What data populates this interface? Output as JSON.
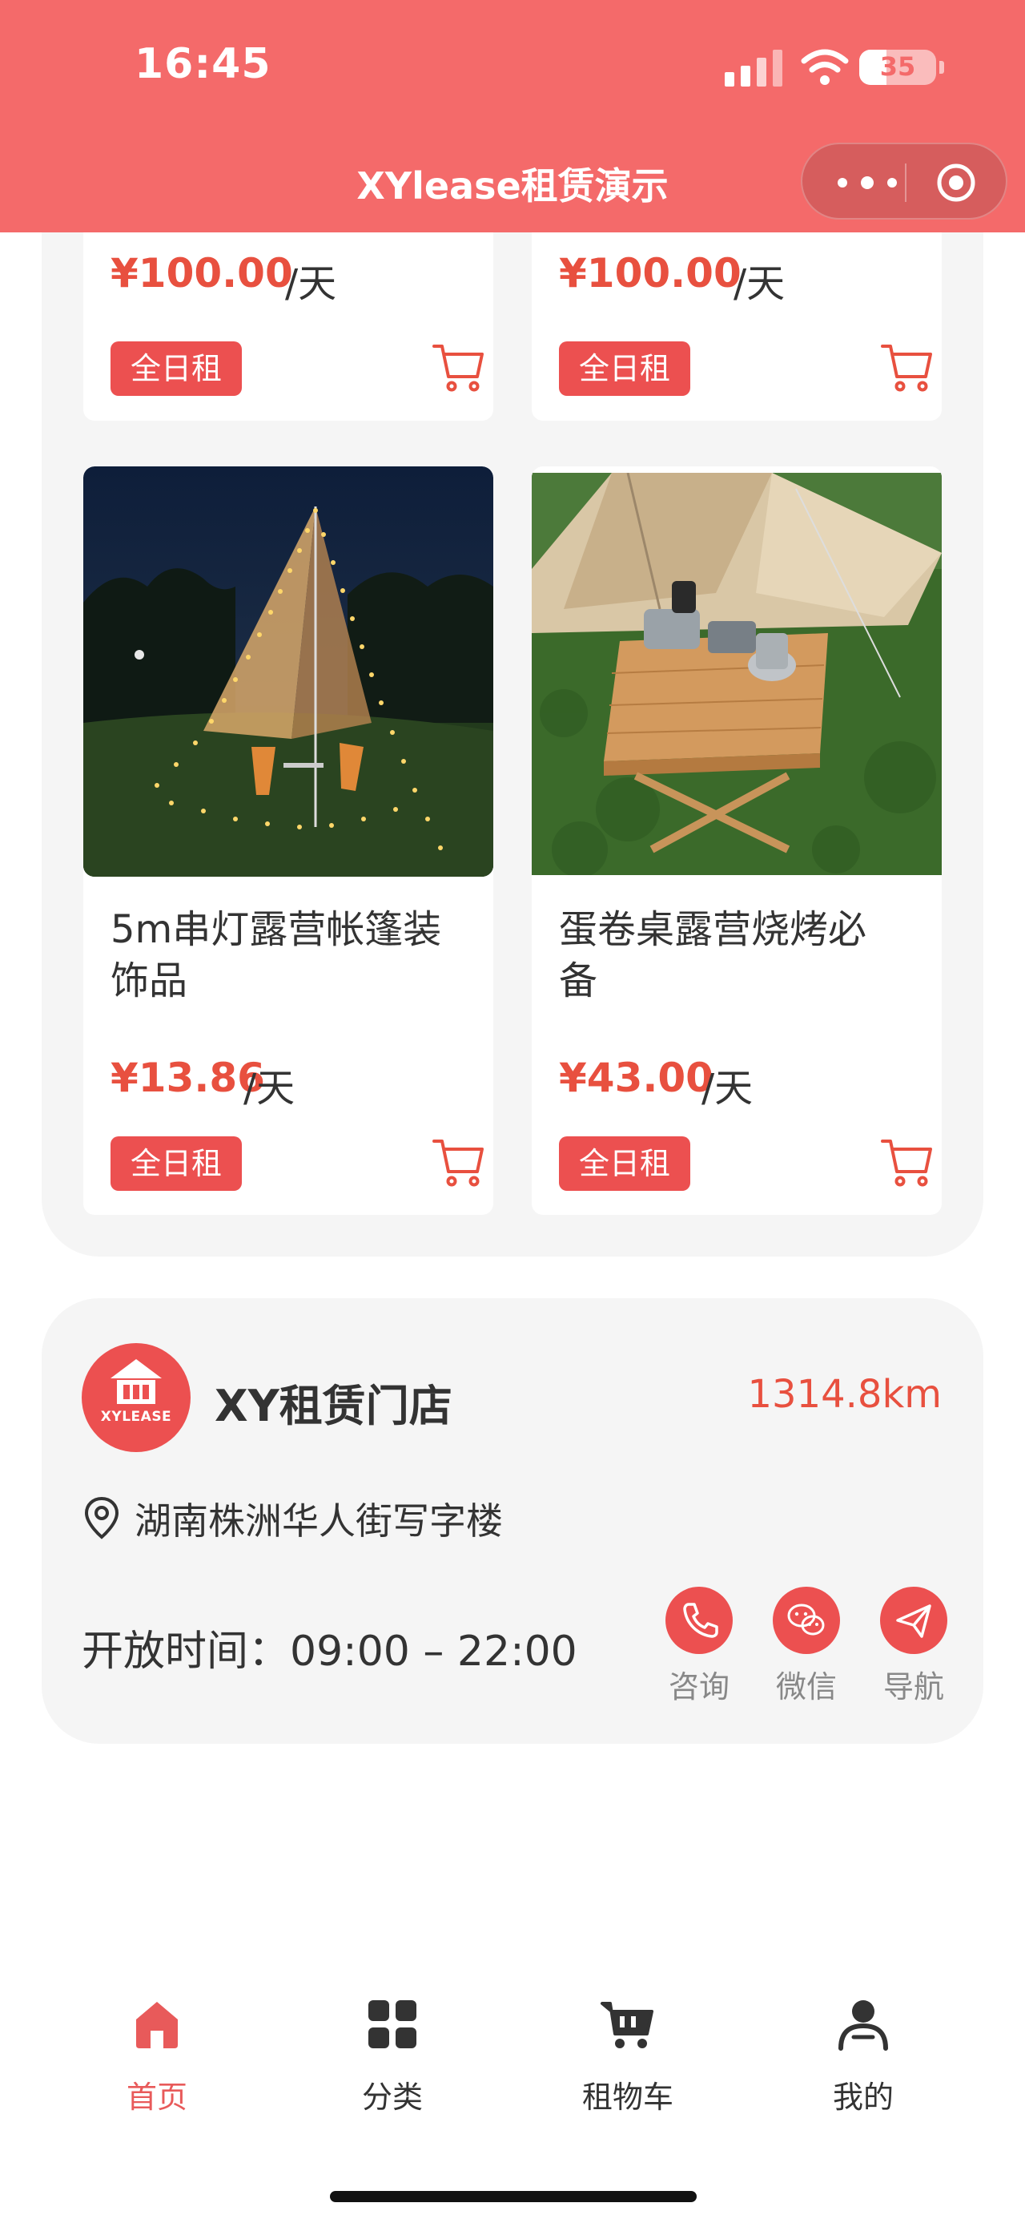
{
  "status_bar": {
    "time": "16:45",
    "battery": "35",
    "battery_level": 0.35
  },
  "nav": {
    "title": "XYlease租赁演示"
  },
  "products": {
    "top_row": [
      {
        "price": "¥100.00",
        "unit": "/天",
        "tag": "全日租"
      },
      {
        "price": "¥100.00",
        "unit": "/天",
        "tag": "全日租"
      }
    ],
    "second_row": [
      {
        "name_line1": "5m串灯露营帐篷装",
        "name_line2": "饰品",
        "price": "¥13.86",
        "unit": "/天",
        "tag": "全日租"
      },
      {
        "name_line1": "蛋卷桌露营烧烤必",
        "name_line2": "备",
        "price": "¥43.00",
        "unit": "/天",
        "tag": "全日租"
      }
    ]
  },
  "store": {
    "logo_text": "XYLEASE",
    "name": "XY租赁门店",
    "distance": "1314.8km",
    "address": "湖南株洲华人街写字楼",
    "hours": "开放时间：09:00 – 22:00",
    "actions": [
      {
        "label": "咨询",
        "icon": "phone-icon"
      },
      {
        "label": "微信",
        "icon": "wechat-icon"
      },
      {
        "label": "导航",
        "icon": "navigation-icon"
      }
    ]
  },
  "tabbar": [
    {
      "label": "首页",
      "icon": "home-icon",
      "active": true
    },
    {
      "label": "分类",
      "icon": "category-grid-icon",
      "active": false
    },
    {
      "label": "租物车",
      "icon": "cart-icon",
      "active": false
    },
    {
      "label": "我的",
      "icon": "user-icon",
      "active": false
    }
  ],
  "colors": {
    "brand": "#f46a6a",
    "accent": "#ec5050",
    "price": "#e8503f",
    "panel": "#f5f5f5"
  }
}
